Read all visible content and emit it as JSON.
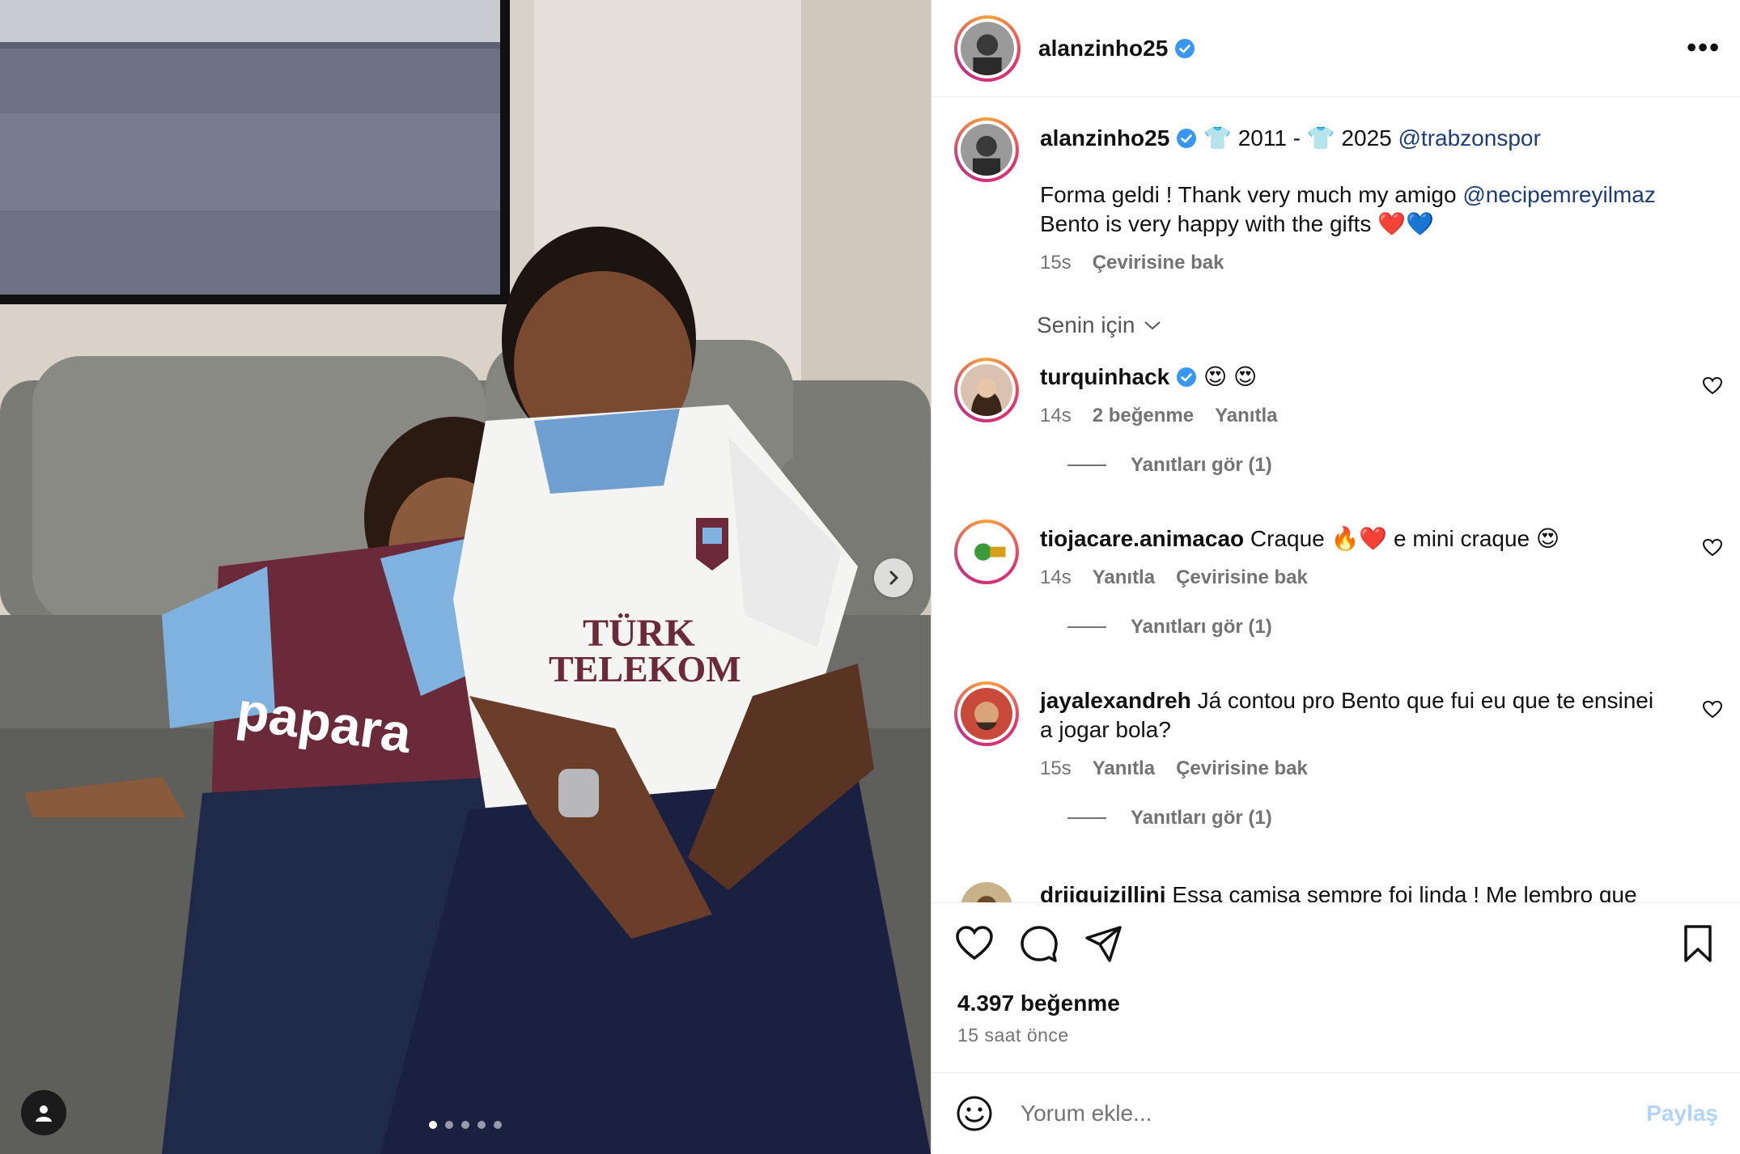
{
  "header": {
    "username": "alanzinho25",
    "verified_icon": "verified-badge-icon",
    "more_icon": "more-options-icon"
  },
  "caption": {
    "username": "alanzinho25",
    "line1_text": "👕 2011 - 👕 2025",
    "line1_mention": "@trabzonspor",
    "line2_text": "Forma geldi ! Thank very much my amigo",
    "line2_mention": "@necipemreyilmaz",
    "line3_text": "Bento is very happy with the gifts ❤️💙",
    "time": "15s",
    "translate": "Çevirisine bak"
  },
  "filter": {
    "label": "Senin için"
  },
  "comments": [
    {
      "username": "turquinhack",
      "verified": true,
      "text": "😍 😍",
      "time": "14s",
      "likes": "2 beğenme",
      "reply": "Yanıtla",
      "view_replies": "Yanıtları gör (1)"
    },
    {
      "username": "tiojacare.animacao",
      "verified": false,
      "text": "Craque 🔥❤️ e mini craque 😍",
      "time": "14s",
      "reply": "Yanıtla",
      "translate": "Çevirisine bak",
      "view_replies": "Yanıtları gör (1)"
    },
    {
      "username": "jayalexandreh",
      "verified": false,
      "text": "Já contou pro Bento que fui eu que te ensinei a jogar bola?",
      "time": "15s",
      "reply": "Yanıtla",
      "translate": "Çevirisine bak",
      "view_replies": "Yanıtları gör (1)"
    },
    {
      "username": "driiguizillini",
      "verified": false,
      "text": "Essa camisa sempre foi linda ! Me lembro que"
    }
  ],
  "actions": {
    "like_icon": "heart-icon",
    "comment_icon": "comment-bubble-icon",
    "share_icon": "send-paper-plane-icon",
    "save_icon": "bookmark-icon",
    "likes_count": "4.397 beğenme",
    "posted": "15 saat önce"
  },
  "comment_box": {
    "placeholder": "Yorum ekle...",
    "submit": "Paylaş",
    "emoji_icon": "emoji-smiley-icon"
  },
  "media": {
    "jersey_text_1": "TÜRK",
    "jersey_text_2": "TELEKOM",
    "kid_shirt_text": "papara",
    "slide_count": 5,
    "active_slide": 1,
    "colors": {
      "trabzon_bordo": "#6b2a3a",
      "trabzon_blue": "#7fb2de",
      "verified_blue": "#3897f0",
      "link_blue": "#1c3d7a"
    }
  }
}
